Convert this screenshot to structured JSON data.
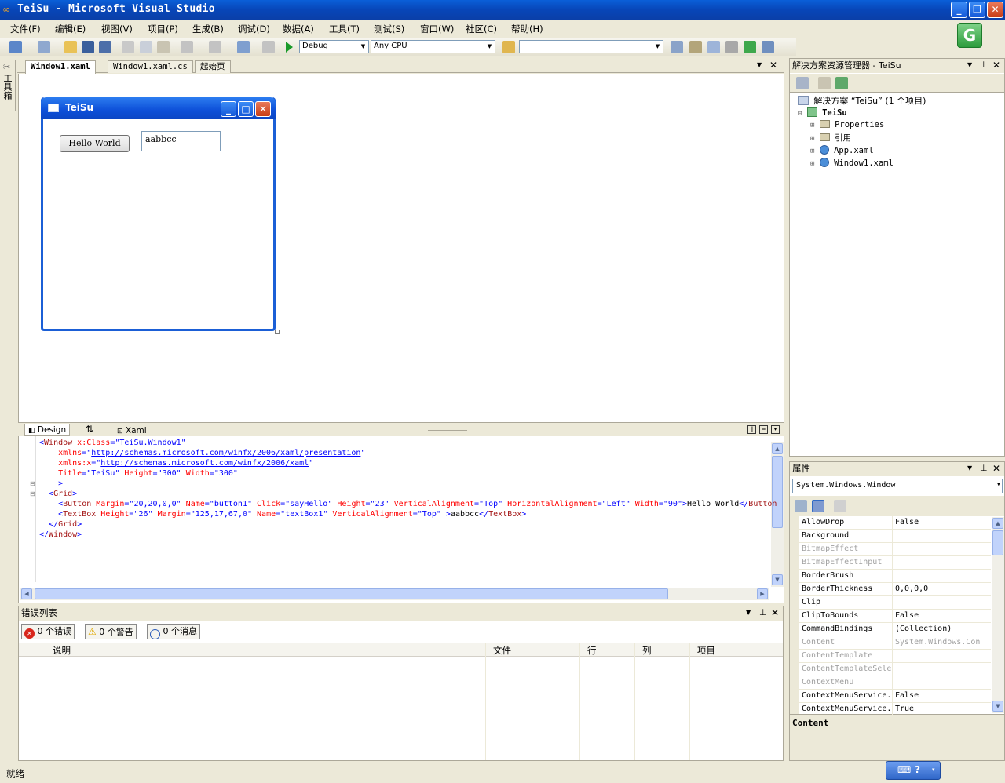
{
  "window": {
    "title": "TeiSu - Microsoft Visual Studio"
  },
  "menubar": [
    "文件(F)",
    "编辑(E)",
    "视图(V)",
    "项目(P)",
    "生成(B)",
    "调试(D)",
    "数据(A)",
    "工具(T)",
    "测试(S)",
    "窗口(W)",
    "社区(C)",
    "帮助(H)"
  ],
  "toolbar": {
    "config": "Debug",
    "platform": "Any CPU",
    "find": ""
  },
  "toolbox": {
    "label": "工具箱"
  },
  "doc_tabs": [
    "Window1.xaml",
    "Window1.xaml.cs",
    "起始页"
  ],
  "designer": {
    "wpf_title": "TeiSu",
    "button_label": "Hello World",
    "textbox_value": "aabbcc"
  },
  "split_tabs": {
    "design": "Design",
    "swap": "⇅",
    "xaml": "Xaml"
  },
  "xaml_lines": [
    {
      "p": [
        {
          "c": "br",
          "t": "<"
        },
        {
          "c": "tag",
          "t": "Window"
        },
        {
          "c": "att",
          "t": " x:Class"
        },
        {
          "c": "br",
          "t": "="
        },
        {
          "c": "val",
          "t": "\"TeiSu.Window1\""
        }
      ]
    },
    {
      "p": [
        {
          "c": "att",
          "t": "    xmlns"
        },
        {
          "c": "br",
          "t": "="
        },
        {
          "c": "val",
          "t": "\""
        },
        {
          "c": "lnk",
          "t": "http://schemas.microsoft.com/winfx/2006/xaml/presentation"
        },
        {
          "c": "val",
          "t": "\""
        }
      ]
    },
    {
      "p": [
        {
          "c": "att",
          "t": "    xmlns:x"
        },
        {
          "c": "br",
          "t": "="
        },
        {
          "c": "val",
          "t": "\""
        },
        {
          "c": "lnk",
          "t": "http://schemas.microsoft.com/winfx/2006/xaml"
        },
        {
          "c": "val",
          "t": "\""
        }
      ]
    },
    {
      "p": [
        {
          "c": "att",
          "t": "    Title"
        },
        {
          "c": "br",
          "t": "="
        },
        {
          "c": "val",
          "t": "\"TeiSu\""
        },
        {
          "c": "att",
          "t": " Height"
        },
        {
          "c": "br",
          "t": "="
        },
        {
          "c": "val",
          "t": "\"300\""
        },
        {
          "c": "att",
          "t": " Width"
        },
        {
          "c": "br",
          "t": "="
        },
        {
          "c": "val",
          "t": "\"300\""
        }
      ]
    },
    {
      "p": [
        {
          "c": "br",
          "t": "    >"
        }
      ]
    },
    {
      "p": [
        {
          "c": "br",
          "t": "  <"
        },
        {
          "c": "tag",
          "t": "Grid"
        },
        {
          "c": "br",
          "t": ">"
        }
      ]
    },
    {
      "p": [
        {
          "c": "br",
          "t": "    <"
        },
        {
          "c": "tag",
          "t": "Button"
        },
        {
          "c": "att",
          "t": " Margin"
        },
        {
          "c": "br",
          "t": "="
        },
        {
          "c": "val",
          "t": "\"20,20,0,0\""
        },
        {
          "c": "att",
          "t": " Name"
        },
        {
          "c": "br",
          "t": "="
        },
        {
          "c": "val",
          "t": "\"button1\""
        },
        {
          "c": "att",
          "t": " Click"
        },
        {
          "c": "br",
          "t": "="
        },
        {
          "c": "val",
          "t": "\"sayHello\""
        },
        {
          "c": "att",
          "t": " Height"
        },
        {
          "c": "br",
          "t": "="
        },
        {
          "c": "val",
          "t": "\"23\""
        },
        {
          "c": "att",
          "t": " VerticalAlignment"
        },
        {
          "c": "br",
          "t": "="
        },
        {
          "c": "val",
          "t": "\"Top\""
        },
        {
          "c": "att",
          "t": " HorizontalAlignment"
        },
        {
          "c": "br",
          "t": "="
        },
        {
          "c": "val",
          "t": "\"Left\""
        },
        {
          "c": "att",
          "t": " Width"
        },
        {
          "c": "br",
          "t": "="
        },
        {
          "c": "val",
          "t": "\"90\""
        },
        {
          "c": "br",
          "t": ">"
        },
        {
          "c": "",
          "t": "Hello World"
        },
        {
          "c": "br",
          "t": "</"
        },
        {
          "c": "tag",
          "t": "Button"
        }
      ]
    },
    {
      "p": [
        {
          "c": "br",
          "t": "    <"
        },
        {
          "c": "tag",
          "t": "TextBox"
        },
        {
          "c": "att",
          "t": " Height"
        },
        {
          "c": "br",
          "t": "="
        },
        {
          "c": "val",
          "t": "\"26\""
        },
        {
          "c": "att",
          "t": " Margin"
        },
        {
          "c": "br",
          "t": "="
        },
        {
          "c": "val",
          "t": "\"125,17,67,0\""
        },
        {
          "c": "att",
          "t": " Name"
        },
        {
          "c": "br",
          "t": "="
        },
        {
          "c": "val",
          "t": "\"textBox1\""
        },
        {
          "c": "att",
          "t": " VerticalAlignment"
        },
        {
          "c": "br",
          "t": "="
        },
        {
          "c": "val",
          "t": "\"Top\""
        },
        {
          "c": "br",
          "t": " >"
        },
        {
          "c": "",
          "t": "aabbcc"
        },
        {
          "c": "br",
          "t": "</"
        },
        {
          "c": "tag",
          "t": "TextBox"
        },
        {
          "c": "br",
          "t": ">"
        }
      ]
    },
    {
      "p": [
        {
          "c": "br",
          "t": "  </"
        },
        {
          "c": "tag",
          "t": "Grid"
        },
        {
          "c": "br",
          "t": ">"
        }
      ]
    },
    {
      "p": [
        {
          "c": "br",
          "t": "</"
        },
        {
          "c": "tag",
          "t": "Window"
        },
        {
          "c": "br",
          "t": ">"
        }
      ]
    }
  ],
  "error_list": {
    "title": "错误列表",
    "errors": "0 个错误",
    "warnings": "0 个警告",
    "messages": "0 个消息",
    "columns": [
      "说明",
      "文件",
      "行",
      "列",
      "项目"
    ]
  },
  "solution_explorer": {
    "title": "解决方案资源管理器 - TeiSu",
    "solution": "解决方案 “TeiSu” (1 个项目)",
    "project": "TeiSu",
    "items": [
      "Properties",
      "引用",
      "App.xaml",
      "Window1.xaml"
    ]
  },
  "properties": {
    "title": "属性",
    "object": "System.Windows.Window",
    "rows": [
      {
        "n": "AllowDrop",
        "v": "False",
        "d": false
      },
      {
        "n": "Background",
        "v": "",
        "d": false
      },
      {
        "n": "BitmapEffect",
        "v": "",
        "d": true
      },
      {
        "n": "BitmapEffectInput",
        "v": "",
        "d": true
      },
      {
        "n": "BorderBrush",
        "v": "",
        "d": false
      },
      {
        "n": "BorderThickness",
        "v": "0,0,0,0",
        "d": false
      },
      {
        "n": "Clip",
        "v": "",
        "d": false
      },
      {
        "n": "ClipToBounds",
        "v": "False",
        "d": false
      },
      {
        "n": "CommandBindings",
        "v": "(Collection)",
        "d": false
      },
      {
        "n": "Content",
        "v": "System.Windows.Con",
        "d": true
      },
      {
        "n": "ContentTemplate",
        "v": "",
        "d": true
      },
      {
        "n": "ContentTemplateSele",
        "v": "",
        "d": true
      },
      {
        "n": "ContextMenu",
        "v": "",
        "d": true
      },
      {
        "n": "ContextMenuService.",
        "v": "False",
        "d": false
      },
      {
        "n": "ContextMenuService.",
        "v": "True",
        "d": false
      }
    ],
    "description_title": "Content"
  },
  "status": {
    "text": "就绪"
  }
}
